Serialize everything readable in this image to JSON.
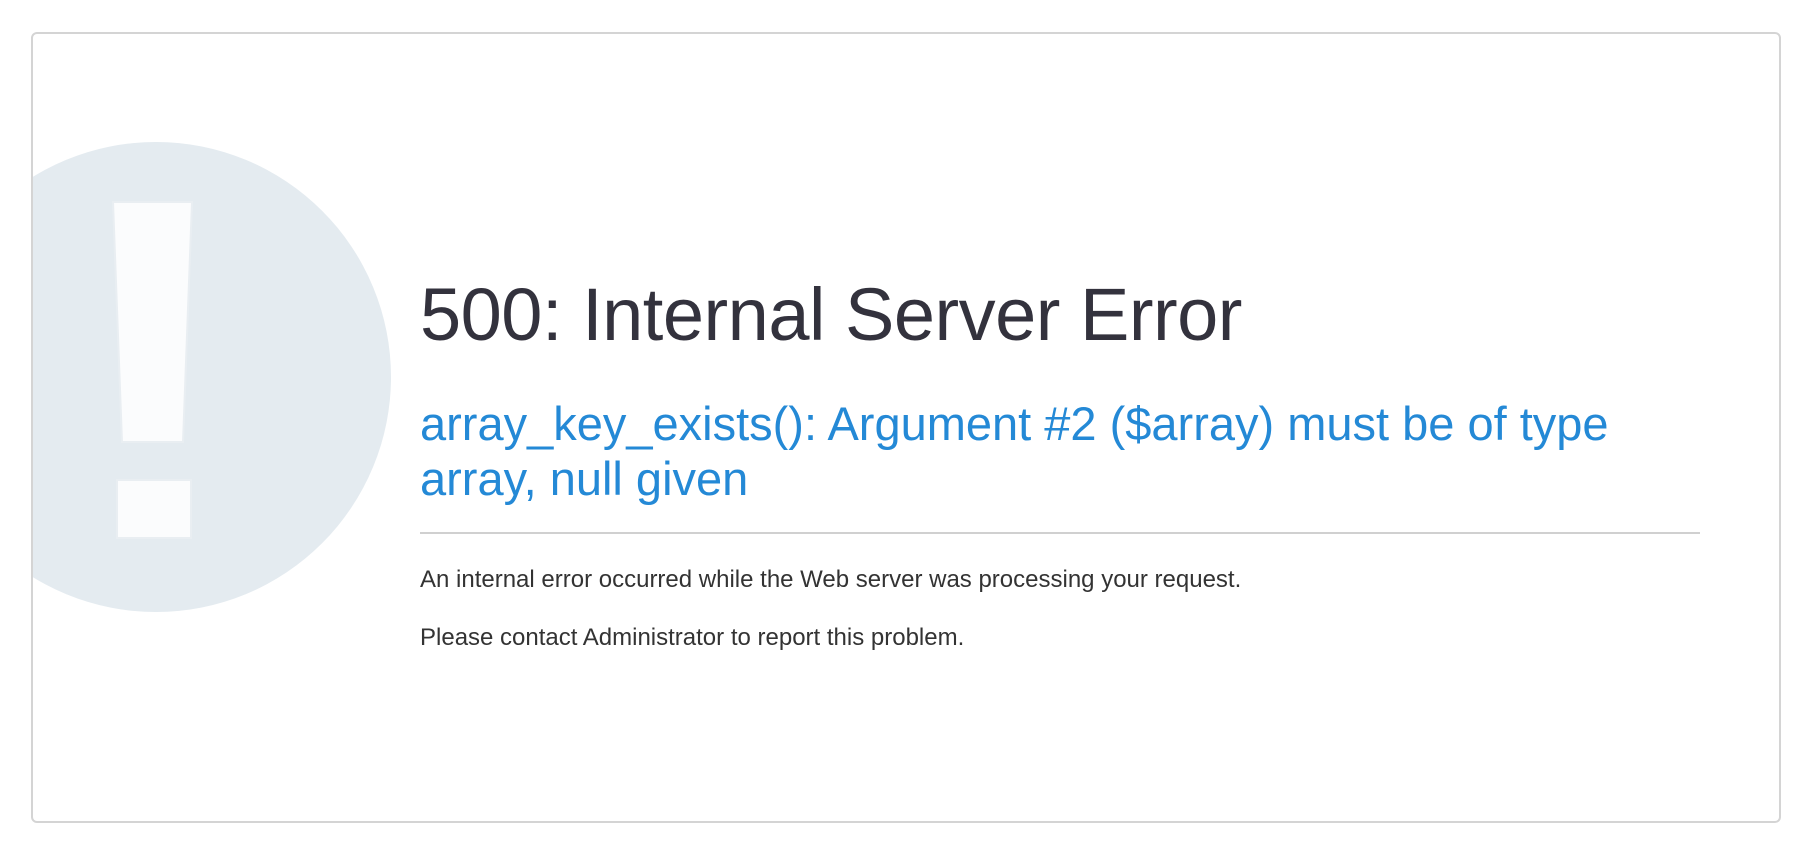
{
  "error": {
    "title": "500: Internal Server Error",
    "message": "array_key_exists(): Argument #2 ($array) must be of type array, null given",
    "description": "An internal error occurred while the Web server was processing your request.",
    "contact": "Please contact Administrator to report this problem."
  },
  "icons": {
    "watermark": "exclamation-icon"
  },
  "colors": {
    "title": "#33323d",
    "message": "#2489d6",
    "watermark_circle": "#e4ebf0",
    "border": "#d4d4d4"
  }
}
